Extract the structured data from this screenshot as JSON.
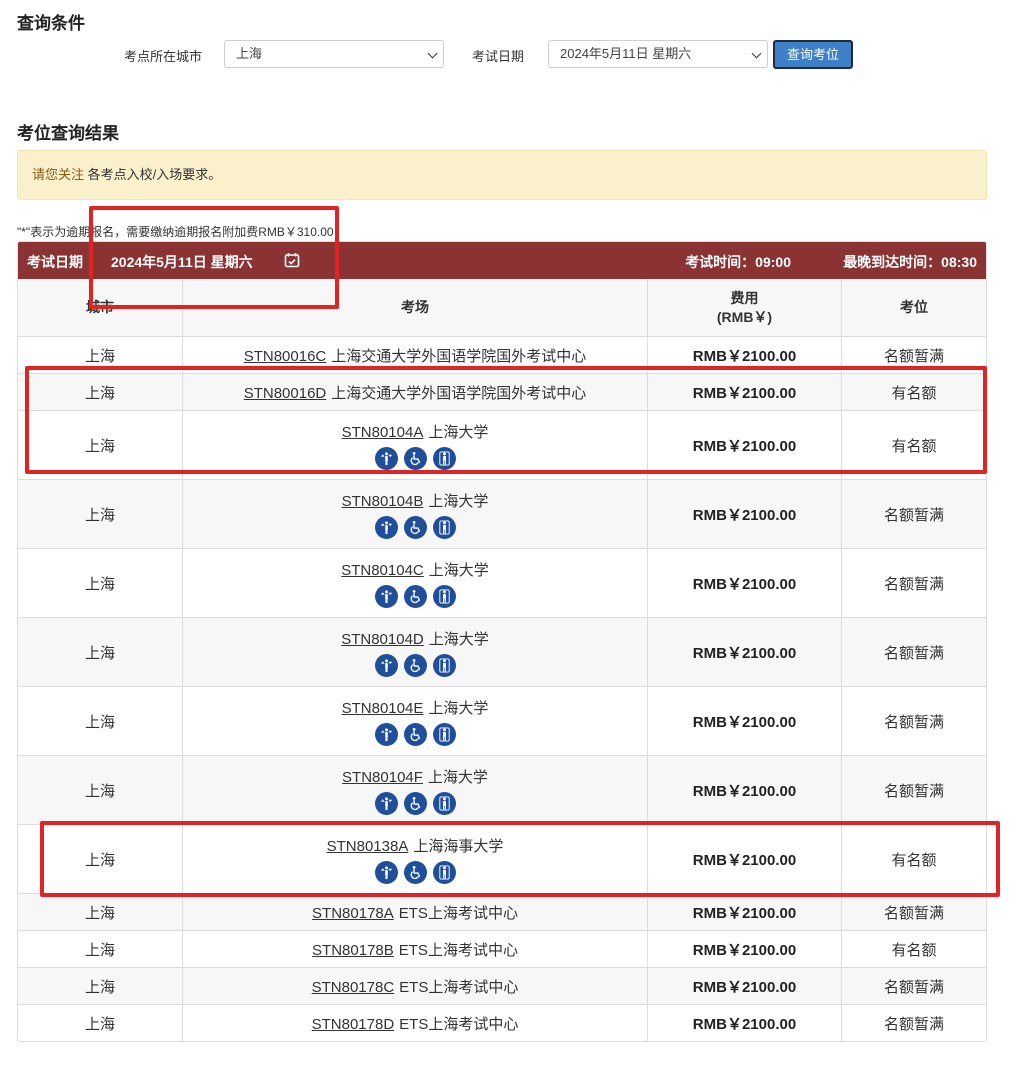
{
  "query": {
    "heading": "查询条件",
    "city_label": "考点所在城市",
    "city_value": "上海",
    "date_label": "考试日期",
    "date_value": "2024年5月11日 星期六",
    "button": "查询考位"
  },
  "results": {
    "heading": "考位查询结果",
    "notice_highlight": "请您关注",
    "notice_text": "各考点入校/入场要求。",
    "late_note": "\"*\"表示为逾期报名，需要缴纳逾期报名附加费RMB￥310.00",
    "bar": {
      "date_label": "考试日期",
      "date_value": "2024年5月11日 星期六",
      "time": "考试时间：09:00",
      "arrive": "最晚到达时间：08:30"
    },
    "columns": {
      "city": "城市",
      "site": "考场",
      "fee_line1": "费用",
      "fee_line2": "(RMB￥)",
      "seat": "考位"
    },
    "rows": [
      {
        "city": "上海",
        "code": "STN80016C",
        "name": "上海交通大学外国语学院国外考试中心",
        "fee": "RMB￥2100.00",
        "seat": "名额暂满",
        "icons": false
      },
      {
        "city": "上海",
        "code": "STN80016D",
        "name": "上海交通大学外国语学院国外考试中心",
        "fee": "RMB￥2100.00",
        "seat": "有名额",
        "icons": false
      },
      {
        "city": "上海",
        "code": "STN80104A",
        "name": "上海大学",
        "fee": "RMB￥2100.00",
        "seat": "有名额",
        "icons": true
      },
      {
        "city": "上海",
        "code": "STN80104B",
        "name": "上海大学",
        "fee": "RMB￥2100.00",
        "seat": "名额暂满",
        "icons": true
      },
      {
        "city": "上海",
        "code": "STN80104C",
        "name": "上海大学",
        "fee": "RMB￥2100.00",
        "seat": "名额暂满",
        "icons": true
      },
      {
        "city": "上海",
        "code": "STN80104D",
        "name": "上海大学",
        "fee": "RMB￥2100.00",
        "seat": "名额暂满",
        "icons": true
      },
      {
        "city": "上海",
        "code": "STN80104E",
        "name": "上海大学",
        "fee": "RMB￥2100.00",
        "seat": "名额暂满",
        "icons": true
      },
      {
        "city": "上海",
        "code": "STN80104F",
        "name": "上海大学",
        "fee": "RMB￥2100.00",
        "seat": "名额暂满",
        "icons": true
      },
      {
        "city": "上海",
        "code": "STN80138A",
        "name": "上海海事大学",
        "fee": "RMB￥2100.00",
        "seat": "有名额",
        "icons": true
      },
      {
        "city": "上海",
        "code": "STN80178A",
        "name": "ETS上海考试中心",
        "fee": "RMB￥2100.00",
        "seat": "名额暂满",
        "icons": false
      },
      {
        "city": "上海",
        "code": "STN80178B",
        "name": "ETS上海考试中心",
        "fee": "RMB￥2100.00",
        "seat": "有名额",
        "icons": false
      },
      {
        "city": "上海",
        "code": "STN80178C",
        "name": "ETS上海考试中心",
        "fee": "RMB￥2100.00",
        "seat": "名额暂满",
        "icons": false
      },
      {
        "city": "上海",
        "code": "STN80178D",
        "name": "ETS上海考试中心",
        "fee": "RMB￥2100.00",
        "seat": "名额暂满",
        "icons": false
      }
    ]
  },
  "icon_names": [
    "elevator-icon",
    "wheelchair-icon",
    "restroom-icon"
  ],
  "colors": {
    "header_bar": "#8b3232",
    "button": "#3d80c8",
    "icon_bg": "#1f4f9b",
    "annotation": "#e02424",
    "notice_bg": "#fbf0cc"
  }
}
